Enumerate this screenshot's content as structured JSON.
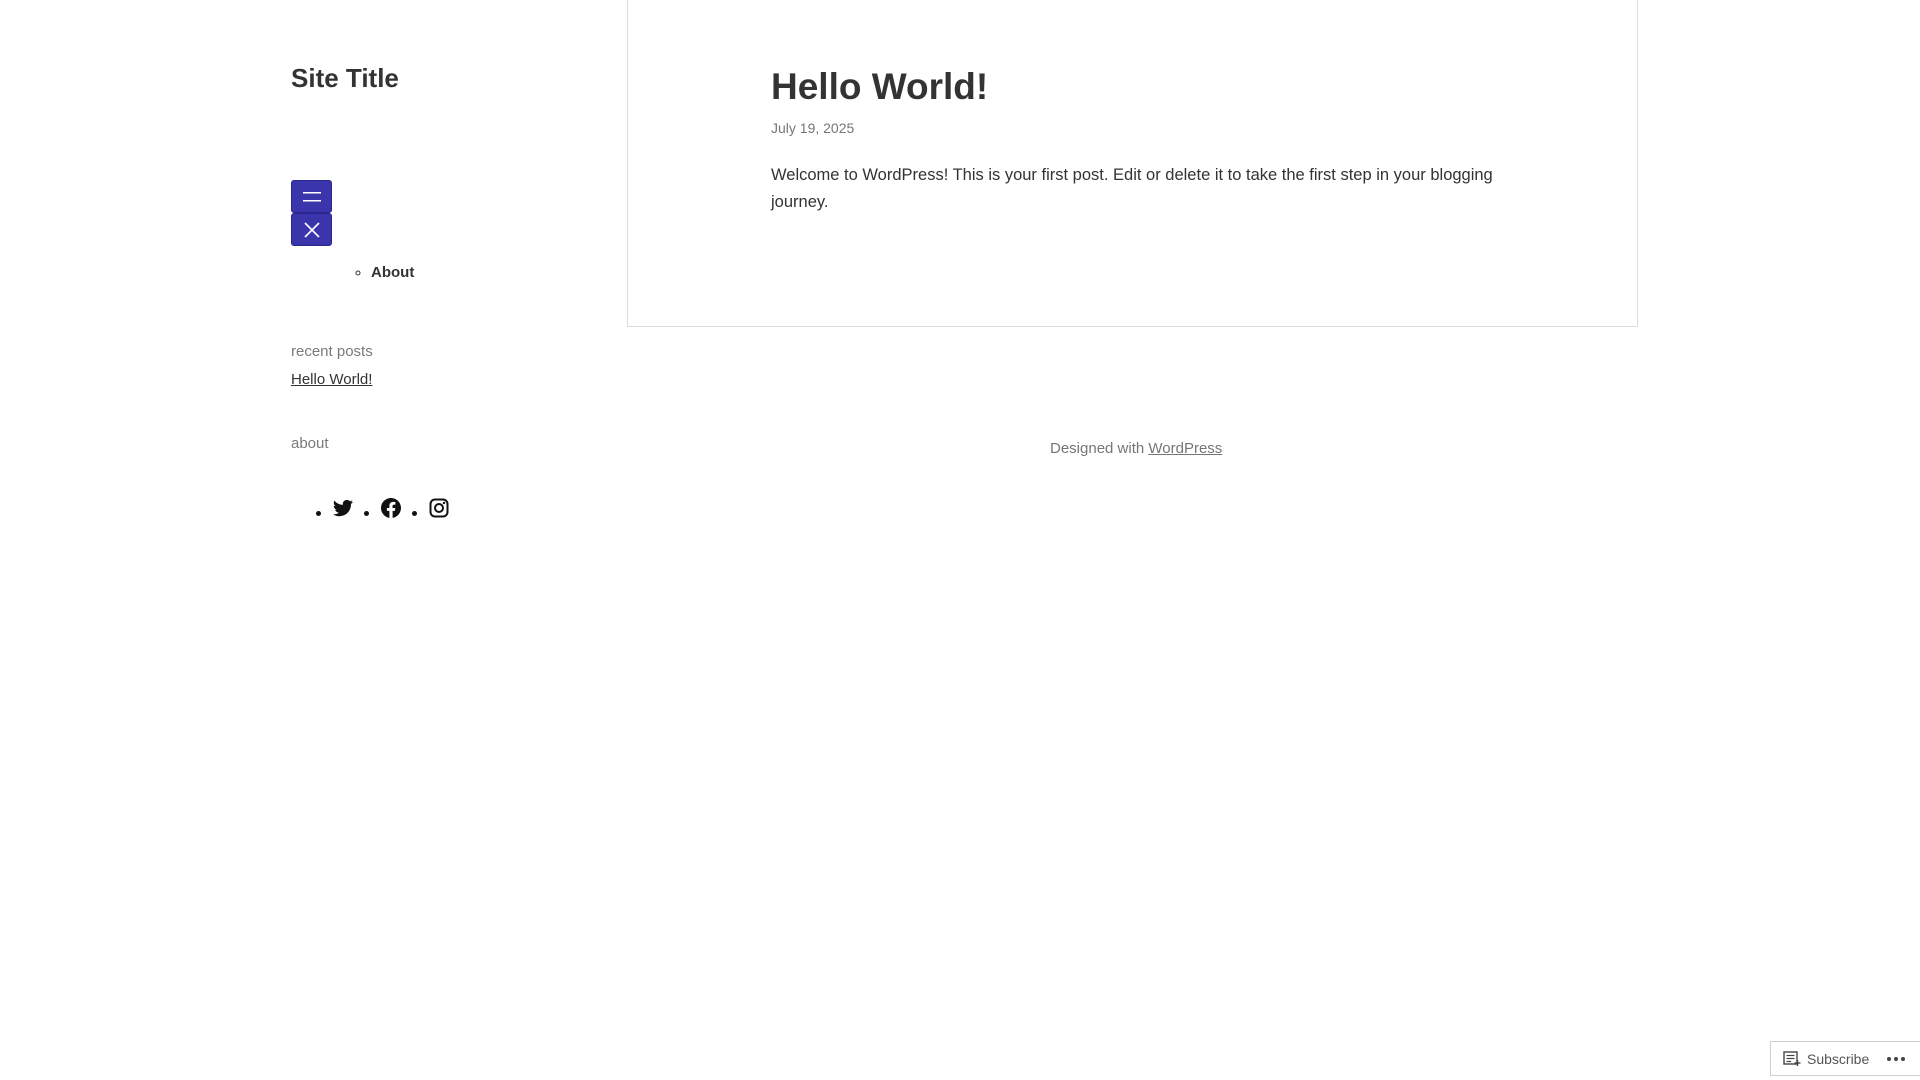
{
  "site": {
    "title": "Site Title"
  },
  "navigation": {
    "items": [
      {
        "label": "About"
      }
    ]
  },
  "sidebar": {
    "recent_posts_heading": "recent posts",
    "recent_posts": [
      {
        "label": "Hello World!"
      }
    ],
    "about_heading": "about",
    "social_icons": [
      "twitter-icon",
      "facebook-icon",
      "instagram-icon"
    ]
  },
  "post": {
    "title": "Hello World!",
    "date": "July 19, 2025",
    "content": "Welcome to WordPress! This is your first post. Edit or delete it to take the first step in your blogging journey."
  },
  "footer": {
    "credit_prefix": "Designed with",
    "credit_link": "WordPress"
  },
  "subscribe_bar": {
    "subscribe_label": "Subscribe",
    "more_icon": "ellipsis-icon"
  },
  "colors": {
    "menu_button_bg": "#3a35ab",
    "text": "#333333",
    "muted": "#767676"
  }
}
